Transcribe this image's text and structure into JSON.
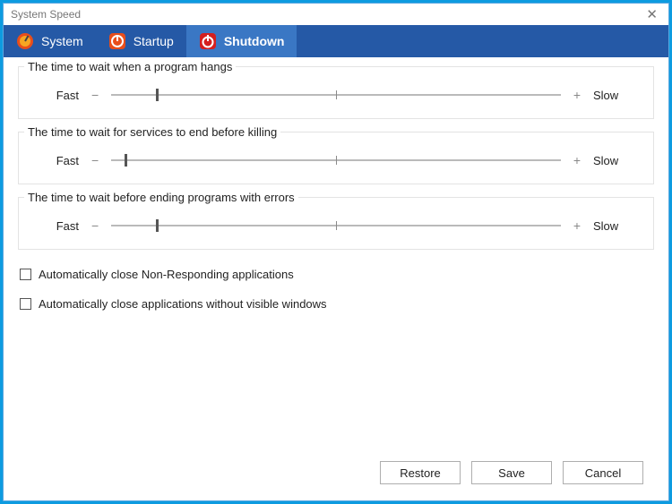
{
  "window": {
    "title": "System Speed"
  },
  "tabs": {
    "system": "System",
    "startup": "Startup",
    "shutdown": "Shutdown"
  },
  "groups": {
    "hang": {
      "legend": "The time to wait when a program hangs",
      "fast": "Fast",
      "slow": "Slow"
    },
    "services": {
      "legend": "The time to wait for services to end before killing",
      "fast": "Fast",
      "slow": "Slow"
    },
    "errors": {
      "legend": "The time to wait before ending programs with errors",
      "fast": "Fast",
      "slow": "Slow"
    }
  },
  "checkboxes": {
    "nonresponding": "Automatically close Non-Responding applications",
    "nowindow": "Automatically close applications without visible windows"
  },
  "buttons": {
    "restore": "Restore",
    "save": "Save",
    "cancel": "Cancel"
  },
  "slider_positions": {
    "hang_pct": 10,
    "services_pct": 3,
    "errors_pct": 10
  }
}
